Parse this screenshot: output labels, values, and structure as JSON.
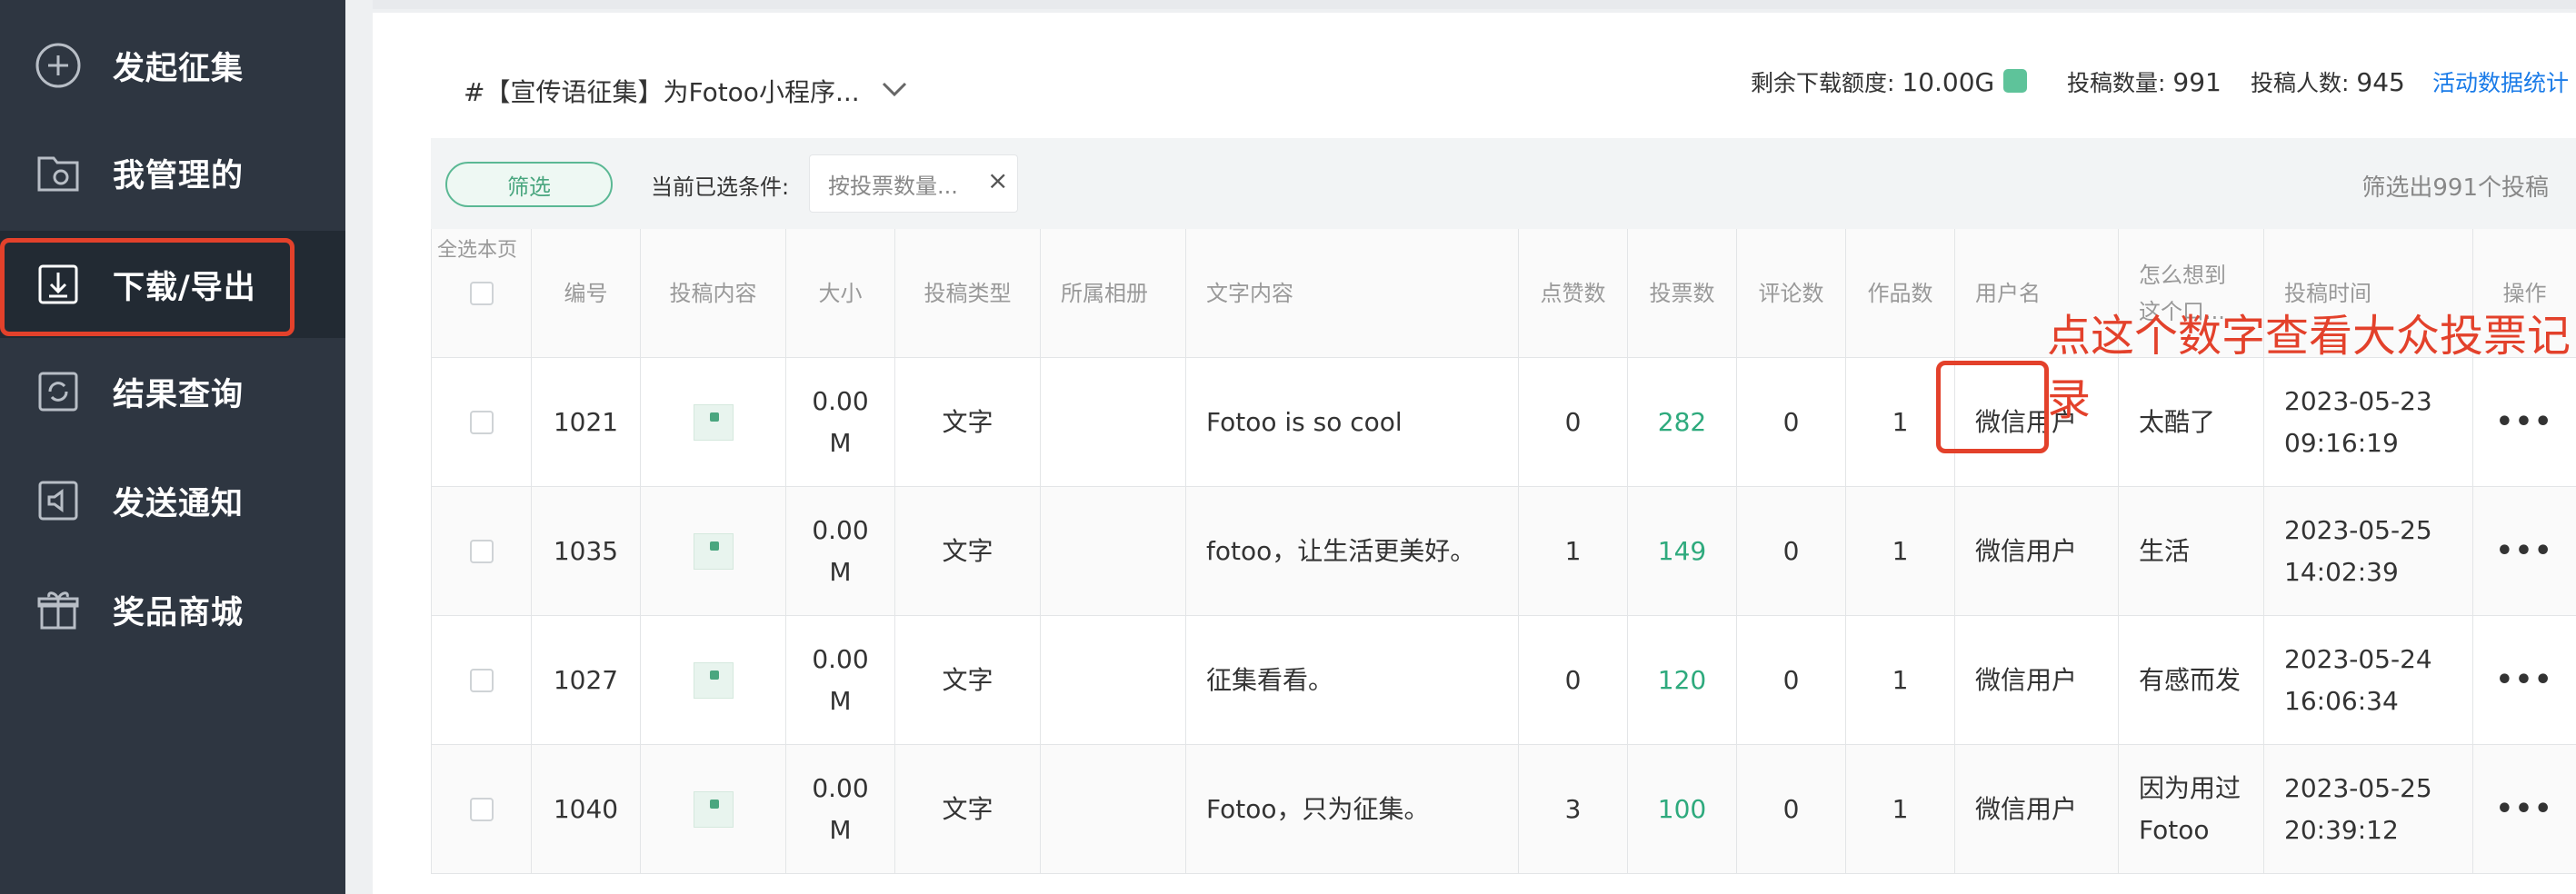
{
  "sidebar": {
    "items": [
      {
        "label": "发起征集",
        "icon": "plus-circle-icon"
      },
      {
        "label": "我管理的",
        "icon": "folder-gear-icon"
      },
      {
        "label": "下载/导出",
        "icon": "download-icon"
      },
      {
        "label": "结果查询",
        "icon": "refresh-icon"
      },
      {
        "label": "发送通知",
        "icon": "speaker-icon"
      },
      {
        "label": "奖品商城",
        "icon": "gift-icon"
      }
    ],
    "active_index": 2
  },
  "header": {
    "activity_title": "#【宣传语征集】为Fotoo小程序...",
    "quota_label": "剩余下载额度:",
    "quota_value": "10.00G",
    "submissions_label": "投稿数量:",
    "submissions_value": "991",
    "submitters_label": "投稿人数:",
    "submitters_value": "945",
    "stats_link": "活动数据统计"
  },
  "filter": {
    "button_label": "筛选",
    "current_label": "当前已选条件:",
    "chip_text": "按投票数量...",
    "result_text": "筛选出991个投稿"
  },
  "table": {
    "select_all_label": "全选本页",
    "columns": [
      "编号",
      "投稿内容",
      "大小",
      "投稿类型",
      "所属相册",
      "文字内容",
      "点赞数",
      "投票数",
      "评论数",
      "作品数",
      "用户名",
      "怎么想到这个口...",
      "投稿时间",
      "操作"
    ],
    "rows": [
      {
        "id": "1021",
        "size": "0.00 M",
        "type": "文字",
        "album": "",
        "text": "Fotoo is so cool",
        "likes": "0",
        "votes": "282",
        "comments": "0",
        "works": "1",
        "user": "微信用户",
        "idea": "太酷了",
        "time": "2023-05-23 09:16:19"
      },
      {
        "id": "1035",
        "size": "0.00 M",
        "type": "文字",
        "album": "",
        "text": "fotoo，让生活更美好。",
        "likes": "1",
        "votes": "149",
        "comments": "0",
        "works": "1",
        "user": "微信用户",
        "idea": "生活",
        "time": "2023-05-25 14:02:39"
      },
      {
        "id": "1027",
        "size": "0.00 M",
        "type": "文字",
        "album": "",
        "text": "征集看看。",
        "likes": "0",
        "votes": "120",
        "comments": "0",
        "works": "1",
        "user": "微信用户",
        "idea": "有感而发",
        "time": "2023-05-24 16:06:34"
      },
      {
        "id": "1040",
        "size": "0.00 M",
        "type": "文字",
        "album": "",
        "text": "Fotoo，只为征集。",
        "likes": "3",
        "votes": "100",
        "comments": "0",
        "works": "1",
        "user": "微信用户",
        "idea": "因为用过Fotoo",
        "time": "2023-05-25 20:39:12"
      }
    ],
    "more_label": "•••"
  },
  "annotation": "点这个数字查看大众投票记录",
  "colors": {
    "accent": "#2eaa7d",
    "highlight": "#e3412b",
    "link": "#1a7be8",
    "sidebar": "#2e3641"
  }
}
